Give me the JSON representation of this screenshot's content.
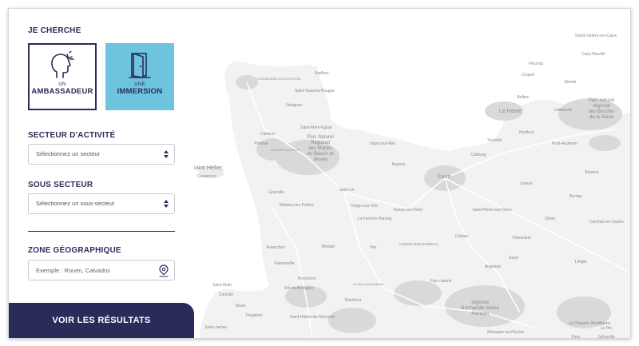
{
  "panel": {
    "heading_search": "JE CHERCHE",
    "cards": [
      {
        "small": "UN",
        "big": "AMBASSADEUR",
        "icon": "speaking-head-icon"
      },
      {
        "small": "UNE",
        "big": "IMMERSION",
        "icon": "open-door-icon"
      }
    ],
    "sector": {
      "label": "SECTEUR D'ACTIVITÉ",
      "value": "Sélectionnez un secteur"
    },
    "subsector": {
      "label": "SOUS SECTEUR",
      "value": "Sélectionnez un sous-secteur"
    },
    "zone": {
      "label": "ZONE GÉOGRAPHIQUE",
      "placeholder": "Exemple : Rouen, Calvados",
      "icon": "location-pin-icon"
    },
    "submit": "VOIR LES RÉSULTATS"
  },
  "map": {
    "colors": {
      "land": "#f2f2f2",
      "sea": "#ffffff",
      "urban": "#d9d9d9",
      "road": "#ffffff",
      "label": "#8a8a8a"
    },
    "labels": [
      {
        "text": "Saint-Valery-en-Caux"
      },
      {
        "text": "Cany-Barville"
      },
      {
        "text": "Fécamp"
      },
      {
        "text": "Criquet"
      },
      {
        "text": "Étretat"
      },
      {
        "text": "Bolbec"
      },
      {
        "text": "Le Havre"
      },
      {
        "text": "Lillebonne"
      },
      {
        "text": "Parc naturel"
      },
      {
        "text": "régional"
      },
      {
        "text": "des Boucles"
      },
      {
        "text": "de la Seine"
      },
      {
        "text": "Honfleur"
      },
      {
        "text": "Trouville"
      },
      {
        "text": "Pont-Audemer"
      },
      {
        "text": "Cabourg"
      },
      {
        "text": "Lisieux"
      },
      {
        "text": "Caen"
      },
      {
        "text": "Bayeux"
      },
      {
        "text": "Brionne"
      },
      {
        "text": "Bernay"
      },
      {
        "text": "Orbec"
      },
      {
        "text": "Vimoutiers"
      },
      {
        "text": "Conches-en-Ouche"
      },
      {
        "text": "Gacé"
      },
      {
        "text": "L'Aigle"
      },
      {
        "text": "Argentan"
      },
      {
        "text": "Falaise"
      },
      {
        "text": "Flers"
      },
      {
        "text": "Vire"
      },
      {
        "text": "Saint-Pierre-sur-Dives"
      },
      {
        "text": "Aunay-sur-Odon"
      },
      {
        "text": "Torigni-sur-Vire"
      },
      {
        "text": "La Ferrière-Harang"
      },
      {
        "text": "Saint-Lô"
      },
      {
        "text": "CONDÉ-SUR-NOIREAU"
      },
      {
        "text": "Barfleur"
      },
      {
        "text": "CHERBOURG-EN-COTENTIN"
      },
      {
        "text": "Saint-Vaast-la-Hougue"
      },
      {
        "text": "Valognes"
      },
      {
        "text": "Saint-Mère-Église"
      },
      {
        "text": "Carteret"
      },
      {
        "text": "Portbail"
      },
      {
        "text": "LA HAYE-DU-PUITS"
      },
      {
        "text": "Isigny-sur-Mer"
      },
      {
        "text": "Parc Naturel"
      },
      {
        "text": "Régional"
      },
      {
        "text": "des Marais"
      },
      {
        "text": "du Bessin et"
      },
      {
        "text": "Jersey"
      },
      {
        "text": "Saint Helier"
      },
      {
        "text": "Coutances"
      },
      {
        "text": "Granville"
      },
      {
        "text": "Villedieu-les-Poêles"
      },
      {
        "text": "Avranches"
      },
      {
        "text": "Mortain"
      },
      {
        "text": "Pontorson"
      },
      {
        "text": "Le Mont-Saint-Michel"
      },
      {
        "text": "Saint-Malo"
      },
      {
        "text": "Dol-de-Bretagne"
      },
      {
        "text": "Cancale"
      },
      {
        "text": "Dinan"
      },
      {
        "text": "Fougères"
      },
      {
        "text": "Saint-James"
      },
      {
        "text": "Saint-Hilaire-du-Harcouët"
      },
      {
        "text": "Domfront"
      },
      {
        "text": "Parc naturel"
      },
      {
        "text": "régional"
      },
      {
        "text": "Normandie-Maine"
      },
      {
        "text": "Alençon"
      },
      {
        "text": "Mortagne-au-Perche"
      },
      {
        "text": "La Chapelle-Montligeon"
      },
      {
        "text": "Le Pin"
      },
      {
        "text": "Jullouville"
      },
      {
        "text": "Flamanville"
      },
      {
        "text": "Villers-Bocage"
      },
      {
        "text": "Laigle"
      },
      {
        "text": "Lessay"
      },
      {
        "text": "Pontaubault"
      },
      {
        "text": "Ducey"
      },
      {
        "text": "Gorron"
      },
      {
        "text": "Ferrières"
      },
      {
        "text": "Carrouges"
      },
      {
        "text": "Sées"
      },
      {
        "text": "Écouché"
      },
      {
        "text": "Putanges"
      },
      {
        "text": "Tinchebray"
      },
      {
        "text": "Percy"
      },
      {
        "text": "Vassy"
      },
      {
        "text": "Thury-Harcourt"
      },
      {
        "text": "Bretteville"
      },
      {
        "text": "Évrecy"
      },
      {
        "text": "Courseulles"
      },
      {
        "text": "Ouistreham"
      },
      {
        "text": "Dives-sur-Mer"
      },
      {
        "text": "Houlgate"
      },
      {
        "text": "Deauville"
      },
      {
        "text": "Beuzeville"
      },
      {
        "text": "Cormeilles"
      },
      {
        "text": "Thiberville"
      },
      {
        "text": "Broglie"
      },
      {
        "text": "Montreuil-l'Argillé"
      },
      {
        "text": "La Barre-en-Ouche"
      },
      {
        "text": "Rugles"
      },
      {
        "text": "Breteuil"
      },
      {
        "text": "Damville"
      },
      {
        "text": "Verneuil"
      },
      {
        "text": "Tourouvre"
      },
      {
        "text": "Moulins-la-Marche"
      },
      {
        "text": "Le Merlerault"
      },
      {
        "text": "Nonant-le-Pin"
      },
      {
        "text": "Exmes"
      },
      {
        "text": "Trun"
      },
      {
        "text": "Chambois"
      },
      {
        "text": "Livarot"
      },
      {
        "text": "Mézidon"
      },
      {
        "text": "Crèvecœur"
      },
      {
        "text": "Dozulé"
      },
      {
        "text": "Troarn"
      },
      {
        "text": "Argences"
      },
      {
        "text": "Bourguébus"
      },
      {
        "text": "Vimont"
      },
      {
        "text": "Saint-Julien"
      },
      {
        "text": "Grandcamp"
      },
      {
        "text": "Carentan"
      },
      {
        "text": "Sainteny"
      },
      {
        "text": "Périers"
      },
      {
        "text": "Marigny"
      },
      {
        "text": "Canisy"
      },
      {
        "text": "Tessy"
      },
      {
        "text": "Saint-Sever"
      },
      {
        "text": "Saint-Pois"
      },
      {
        "text": "Juvigny"
      },
      {
        "text": "Sourdeval"
      },
      {
        "text": "Le Teilleul"
      },
      {
        "text": "Barenton"
      },
      {
        "text": "Passais"
      },
      {
        "text": "La Ferté-Macé"
      },
      {
        "text": "Briouze"
      },
      {
        "text": "Athis"
      },
      {
        "text": "Messei"
      },
      {
        "text": "Bagnoles"
      },
      {
        "text": "Juvigny-sous-Andaine"
      }
    ]
  }
}
